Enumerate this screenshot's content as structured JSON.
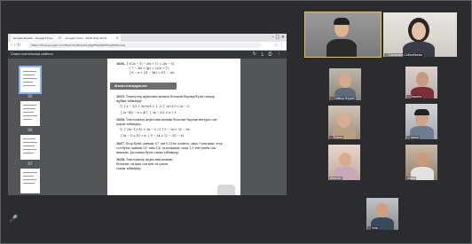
{
  "browser": {
    "tabs": [
      {
        "label": "Google Sheets - Google Drive"
      },
      {
        "label": "Google Drive - 2020 files Word"
      }
    ],
    "url": "https://drive.google.com/file/d/1o2Hkj1i0CyZgNf3qA6Mh5rAwP6Z/view"
  },
  "pdf": {
    "title": "Самостоятельные работы",
    "section_label": "Кетсотеррыге",
    "exercise_numbers": [
      "1034.",
      "1035.",
      "1036.",
      "1037.",
      "1038."
    ]
  },
  "thumbnails": [
    {
      "num": "65"
    },
    {
      "num": "66"
    },
    {
      "num": "67"
    },
    {
      "num": "68"
    }
  ],
  "participants": [
    {
      "name": "",
      "muted": false,
      "speaker": true
    },
    {
      "name": "Сапарова Сабакбаева",
      "muted": false,
      "speaker": false
    },
    {
      "name": "Сабыр Нурай",
      "muted": true,
      "speaker": false
    },
    {
      "name": "Зарина",
      "muted": true,
      "speaker": false
    },
    {
      "name": "Елена",
      "muted": true,
      "speaker": false
    },
    {
      "name": "Аиша",
      "muted": true,
      "speaker": false
    },
    {
      "name": "Фаизат",
      "muted": false,
      "speaker": false
    },
    {
      "name": "Айша",
      "muted": false,
      "speaker": false
    },
    {
      "name": "Інар",
      "muted": true,
      "speaker": false
    }
  ],
  "colors": {
    "background": "#2b2c30",
    "speaker_outline": "#f2c230",
    "mic_active": "#3ec46d",
    "mic_muted": "#e74c3c"
  }
}
